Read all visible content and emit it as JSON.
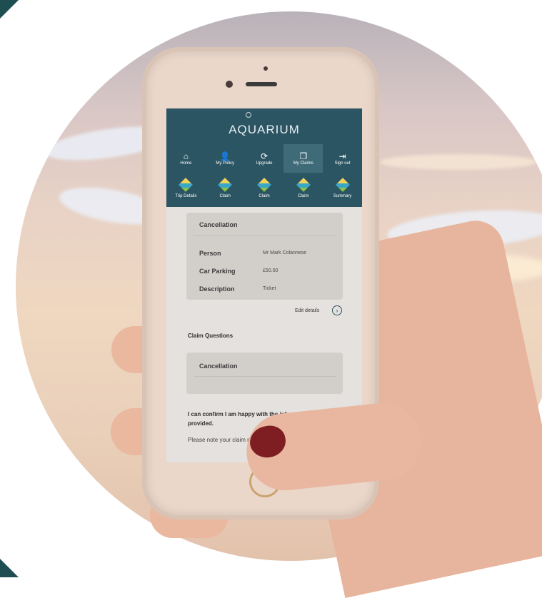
{
  "app": {
    "title": "AQUARIUM"
  },
  "nav": {
    "items": [
      {
        "label": "Home",
        "icon": "home-icon",
        "glyph": "⌂"
      },
      {
        "label": "My Policy",
        "icon": "user-icon",
        "glyph": "👤"
      },
      {
        "label": "Upgrade",
        "icon": "refresh-icon",
        "glyph": "⟳"
      },
      {
        "label": "My Claims",
        "icon": "claims-icon",
        "glyph": "❐"
      },
      {
        "label": "Sign out",
        "icon": "sign-out-icon",
        "glyph": "⇥"
      }
    ],
    "active": "My Claims"
  },
  "steps": [
    {
      "label": "Trip Details",
      "icon": "cube-icon"
    },
    {
      "label": "Claim",
      "icon": "cube-icon"
    },
    {
      "label": "Claim",
      "icon": "cube-icon"
    },
    {
      "label": "Claim",
      "icon": "cube-icon"
    },
    {
      "label": "Summary",
      "icon": "gift-icon"
    }
  ],
  "card": {
    "title": "Cancellation",
    "rows": [
      {
        "label": "Person",
        "value": "Mr Mark Colannese"
      },
      {
        "label": "Car Parking",
        "value": "£50.00"
      },
      {
        "label": "Description",
        "value": "Ticket"
      }
    ]
  },
  "edit_details": "Edit details",
  "claim_questions": {
    "heading": "Claim Questions",
    "card_title": "Cancellation"
  },
  "confirm_text": "I can confirm I am happy with the information I have provided.",
  "note_text": "Please note your claim may be subject to excess and limits",
  "colors": {
    "header": "#2c5563",
    "active_tab": "#3f6b78",
    "card": "#d2cfcb"
  }
}
